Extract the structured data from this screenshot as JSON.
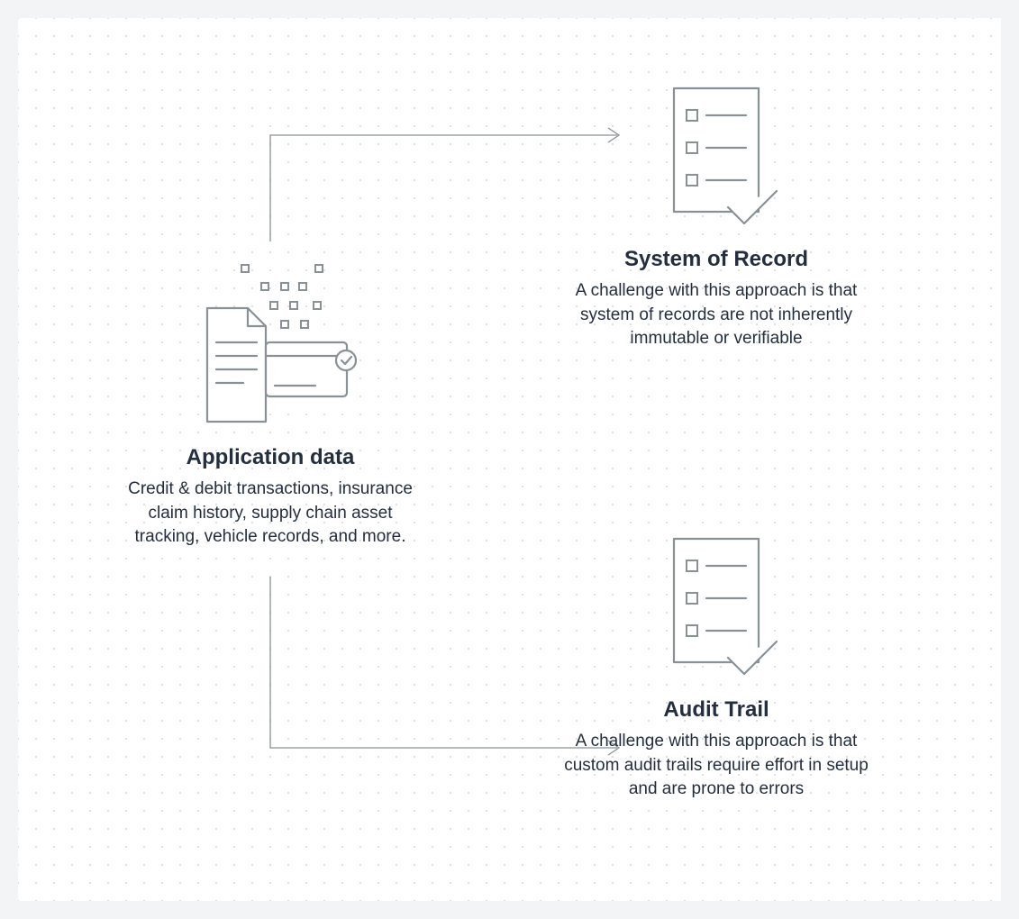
{
  "nodes": {
    "application_data": {
      "title": "Application data",
      "description": "Credit & debit transactions, insurance claim history, supply chain asset tracking, vehicle records, and more."
    },
    "system_of_record": {
      "title": "System of Record",
      "description": "A challenge with this approach is that system of records are not inherently immutable or verifiable"
    },
    "audit_trail": {
      "title": "Audit Trail",
      "description": "A challenge with this approach is that custom audit trails require effort in setup and are prone to errors"
    }
  }
}
